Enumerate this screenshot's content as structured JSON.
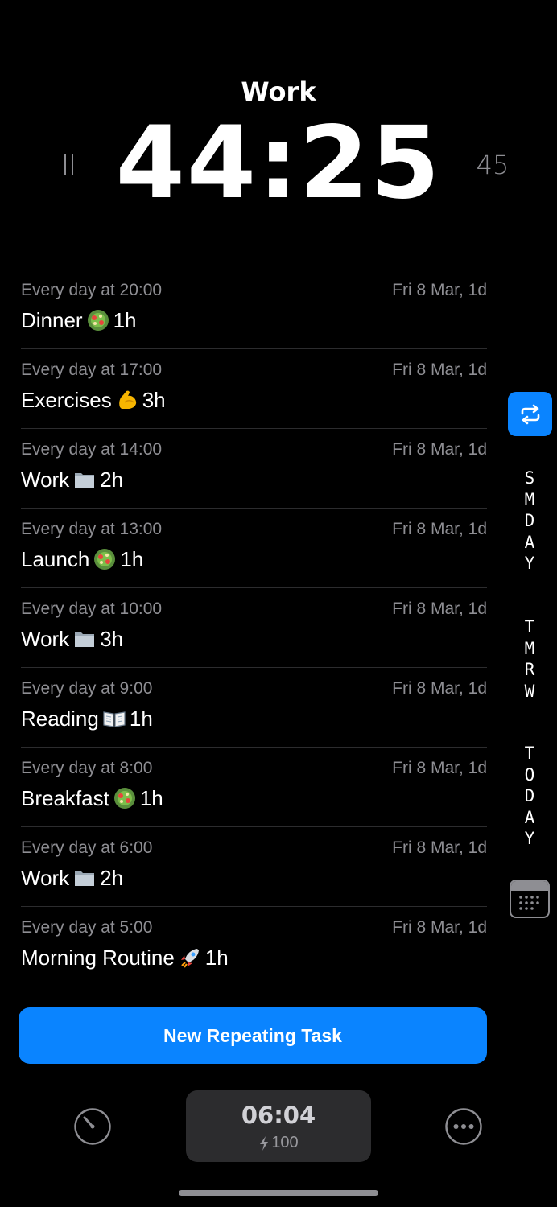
{
  "timer": {
    "title": "Work",
    "remaining": "44:25",
    "duration": "45"
  },
  "tasks": [
    {
      "schedule": "Every day at 20:00",
      "date": "Fri 8 Mar, 1d",
      "name": "Dinner",
      "icon": "salad-icon",
      "duration": "1h"
    },
    {
      "schedule": "Every day at 17:00",
      "date": "Fri 8 Mar, 1d",
      "name": "Exercises",
      "icon": "flexed-biceps-icon",
      "duration": "3h"
    },
    {
      "schedule": "Every day at 14:00",
      "date": "Fri 8 Mar, 1d",
      "name": "Work",
      "icon": "folder-icon",
      "duration": "2h"
    },
    {
      "schedule": "Every day at 13:00",
      "date": "Fri 8 Mar, 1d",
      "name": "Launch",
      "icon": "salad-icon",
      "duration": "1h"
    },
    {
      "schedule": "Every day at 10:00",
      "date": "Fri 8 Mar, 1d",
      "name": "Work",
      "icon": "folder-icon",
      "duration": "3h"
    },
    {
      "schedule": "Every day at 9:00",
      "date": "Fri 8 Mar, 1d",
      "name": "Reading",
      "icon": "open-book-icon",
      "duration": "1h"
    },
    {
      "schedule": "Every day at 8:00",
      "date": "Fri 8 Mar, 1d",
      "name": "Breakfast",
      "icon": "salad-icon",
      "duration": "1h"
    },
    {
      "schedule": "Every day at 6:00",
      "date": "Fri 8 Mar, 1d",
      "name": "Work",
      "icon": "folder-icon",
      "duration": "2h"
    },
    {
      "schedule": "Every day at 5:00",
      "date": "Fri 8 Mar, 1d",
      "name": "Morning Routine",
      "icon": "rocket-icon",
      "duration": "1h"
    }
  ],
  "side_nav": {
    "someday": "SMDAY",
    "tomorrow": "TMRW",
    "today": "TODAY"
  },
  "new_task_button": "New Repeating Task",
  "bottom_bar": {
    "clock_time": "06:04",
    "energy": "100"
  },
  "colors": {
    "accent": "#0a84ff",
    "background": "#000000",
    "secondary_text": "#8e8e93",
    "card": "#2c2c2e"
  }
}
